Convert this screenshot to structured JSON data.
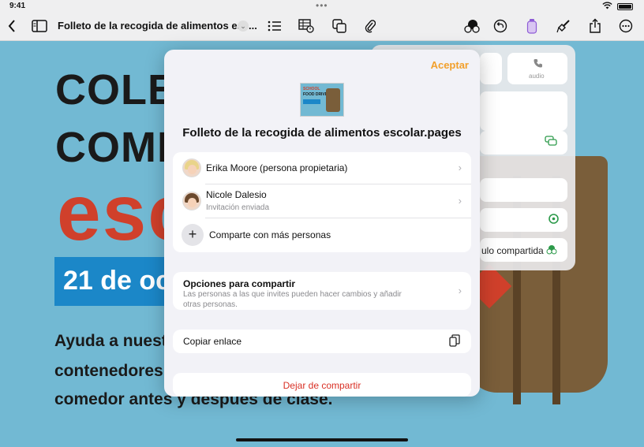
{
  "status": {
    "time": "9:41"
  },
  "toolbar": {
    "doc_title": "Folleto de la recogida de alimentos esc...",
    "icons": [
      "back-icon",
      "sidebar-icon",
      "chevron-down-icon",
      "list-icon",
      "table-icon",
      "shapes-icon",
      "paperclip-icon",
      "collaborate-icon",
      "undo-icon",
      "format-icon",
      "brush-icon",
      "share-icon",
      "more-icon"
    ]
  },
  "document": {
    "line1": "COLEG",
    "line2": "COMI",
    "line3": "esc",
    "date": "21 de oc",
    "body1": "Ayuda a nuest",
    "body2": "contenedores",
    "body3": "comedor antes y después de clase.",
    "colors": {
      "background": "#72b9d3",
      "accent_red": "#d0402b",
      "banner_blue": "#1b87c8"
    }
  },
  "back_popover": {
    "audio_label": "audio",
    "shared_text": "ulo compartida"
  },
  "share_sheet": {
    "accept_label": "Aceptar",
    "thumbnail": {
      "line1": "SCHOOL",
      "line2": "FOOD DRIVE"
    },
    "title": "Folleto de la recogida de alimentos escolar.pages",
    "people": [
      {
        "name": "Erika Moore (persona propietaria)",
        "subtitle": ""
      },
      {
        "name": "Nicole Dalesio",
        "subtitle": "Invitación enviada"
      }
    ],
    "add_people_label": "Comparte con más personas",
    "options": {
      "title": "Opciones para compartir",
      "subtitle": "Las personas a las que invites pueden hacer cambios y añadir otras personas."
    },
    "copy_link_label": "Copiar enlace",
    "stop_sharing_label": "Dejar de compartir",
    "accent_color": "#f2a02c",
    "destructive_color": "#d93025"
  }
}
